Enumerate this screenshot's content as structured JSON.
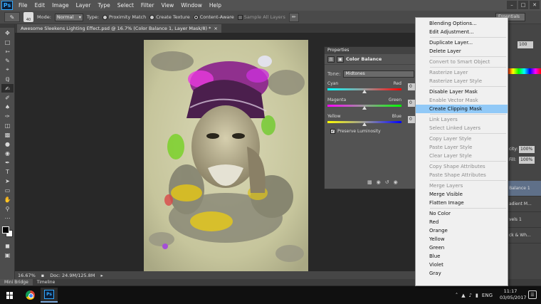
{
  "app": {
    "logo": "Ps",
    "menu": [
      "File",
      "Edit",
      "Image",
      "Layer",
      "Type",
      "Select",
      "Filter",
      "View",
      "Window",
      "Help"
    ],
    "window_controls": [
      "–",
      "□",
      "✕"
    ]
  },
  "options_bar": {
    "brush_size": "40",
    "mode_label": "Mode:",
    "mode_value": "Normal",
    "type_label": "Type:",
    "proximity_match": "Proximity Match",
    "create_texture": "Create Texture",
    "content_aware": "Content-Aware",
    "sample_all_layers": "Sample All Layers",
    "selected_type": "Content-Aware",
    "workspace": "Essentials"
  },
  "document": {
    "tab_title": "Awesome Sleekens Lighting Effect.psd @ 16.7% (Color Balance 1, Layer Mask/8) *",
    "tab_close": "×",
    "zoom": "16.67%",
    "doc_size": "Doc: 24.9M/125.8M"
  },
  "bottom_tabs": [
    "Mini Bridge",
    "Timeline"
  ],
  "properties": {
    "tab_label": "Properties",
    "title": "Color Balance",
    "tone_label": "Tone:",
    "tone_value": "Midtones",
    "sliders": [
      {
        "left": "Cyan",
        "right": "Red",
        "value": "0",
        "position": 0.5,
        "gradient": [
          "#00ffff",
          "#ff0000"
        ]
      },
      {
        "left": "Magenta",
        "right": "Green",
        "value": "0",
        "position": 0.5,
        "gradient": [
          "#ff00ff",
          "#00ff00"
        ]
      },
      {
        "left": "Yellow",
        "right": "Blue",
        "value": "0",
        "position": 0.5,
        "gradient": [
          "#ffff00",
          "#0000ff"
        ]
      }
    ],
    "preserve_luminosity": "Preserve Luminosity",
    "preserve_checked": true
  },
  "dock": {
    "zoom_value": "100",
    "opacity_label": "city:",
    "opacity_value": "100%",
    "fill_label": "Fill:",
    "fill_value": "100%",
    "layers": [
      "Balance 1",
      "adient M...",
      "vels 1",
      "ck & Wh..."
    ]
  },
  "context_menu": {
    "highlighted": "Create Clipping Mask",
    "groups": [
      [
        {
          "label": "Blending Options...",
          "enabled": true
        },
        {
          "label": "Edit Adjustment...",
          "enabled": true
        }
      ],
      [
        {
          "label": "Duplicate Layer...",
          "enabled": true
        },
        {
          "label": "Delete Layer",
          "enabled": true
        }
      ],
      [
        {
          "label": "Convert to Smart Object",
          "enabled": false
        }
      ],
      [
        {
          "label": "Rasterize Layer",
          "enabled": false
        },
        {
          "label": "Rasterize Layer Style",
          "enabled": false
        }
      ],
      [
        {
          "label": "Disable Layer Mask",
          "enabled": true
        },
        {
          "label": "Enable Vector Mask",
          "enabled": false
        },
        {
          "label": "Create Clipping Mask",
          "enabled": true
        }
      ],
      [
        {
          "label": "Link Layers",
          "enabled": false
        },
        {
          "label": "Select Linked Layers",
          "enabled": false
        }
      ],
      [
        {
          "label": "Copy Layer Style",
          "enabled": false
        },
        {
          "label": "Paste Layer Style",
          "enabled": false
        },
        {
          "label": "Clear Layer Style",
          "enabled": false
        }
      ],
      [
        {
          "label": "Copy Shape Attributes",
          "enabled": false
        },
        {
          "label": "Paste Shape Attributes",
          "enabled": false
        }
      ],
      [
        {
          "label": "Merge Layers",
          "enabled": false
        },
        {
          "label": "Merge Visible",
          "enabled": true
        },
        {
          "label": "Flatten Image",
          "enabled": true
        }
      ],
      [
        {
          "label": "No Color",
          "enabled": true
        },
        {
          "label": "Red",
          "enabled": true
        },
        {
          "label": "Orange",
          "enabled": true
        },
        {
          "label": "Yellow",
          "enabled": true
        },
        {
          "label": "Green",
          "enabled": true
        },
        {
          "label": "Blue",
          "enabled": true
        },
        {
          "label": "Violet",
          "enabled": true
        },
        {
          "label": "Gray",
          "enabled": true
        }
      ]
    ]
  },
  "taskbar": {
    "language": "ENG",
    "time": "11:17",
    "date": "03/05/2017"
  },
  "colors": {
    "menu_highlight": "#91c9f7",
    "selected_layer": "#5f7089",
    "ps_blue": "#31a8ff"
  }
}
